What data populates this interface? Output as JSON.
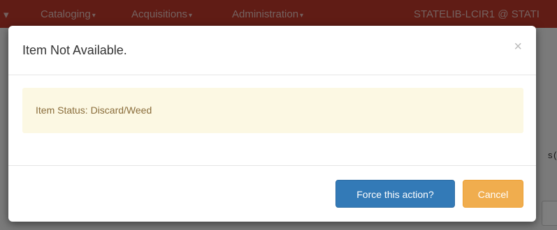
{
  "navbar": {
    "items": [
      {
        "label": "Cataloging",
        "caret": "▾"
      },
      {
        "label": "Acquisitions",
        "caret": "▾"
      },
      {
        "label": "Administration",
        "caret": "▾"
      }
    ],
    "user_label": "STATELIB-LCIR1 @ STATI"
  },
  "background": {
    "fragment_1": "s",
    "fragment_2": "("
  },
  "modal": {
    "title": "Item Not Available.",
    "close_glyph": "×",
    "alert_text": "Item Status: Discard/Weed",
    "force_label": "Force this action?",
    "cancel_label": "Cancel"
  },
  "colors": {
    "navbar": "#c0392b",
    "primary": "#337ab7",
    "warning": "#f0ad4e",
    "alert_bg": "#fcf8e3",
    "alert_text": "#8a6d3b"
  }
}
